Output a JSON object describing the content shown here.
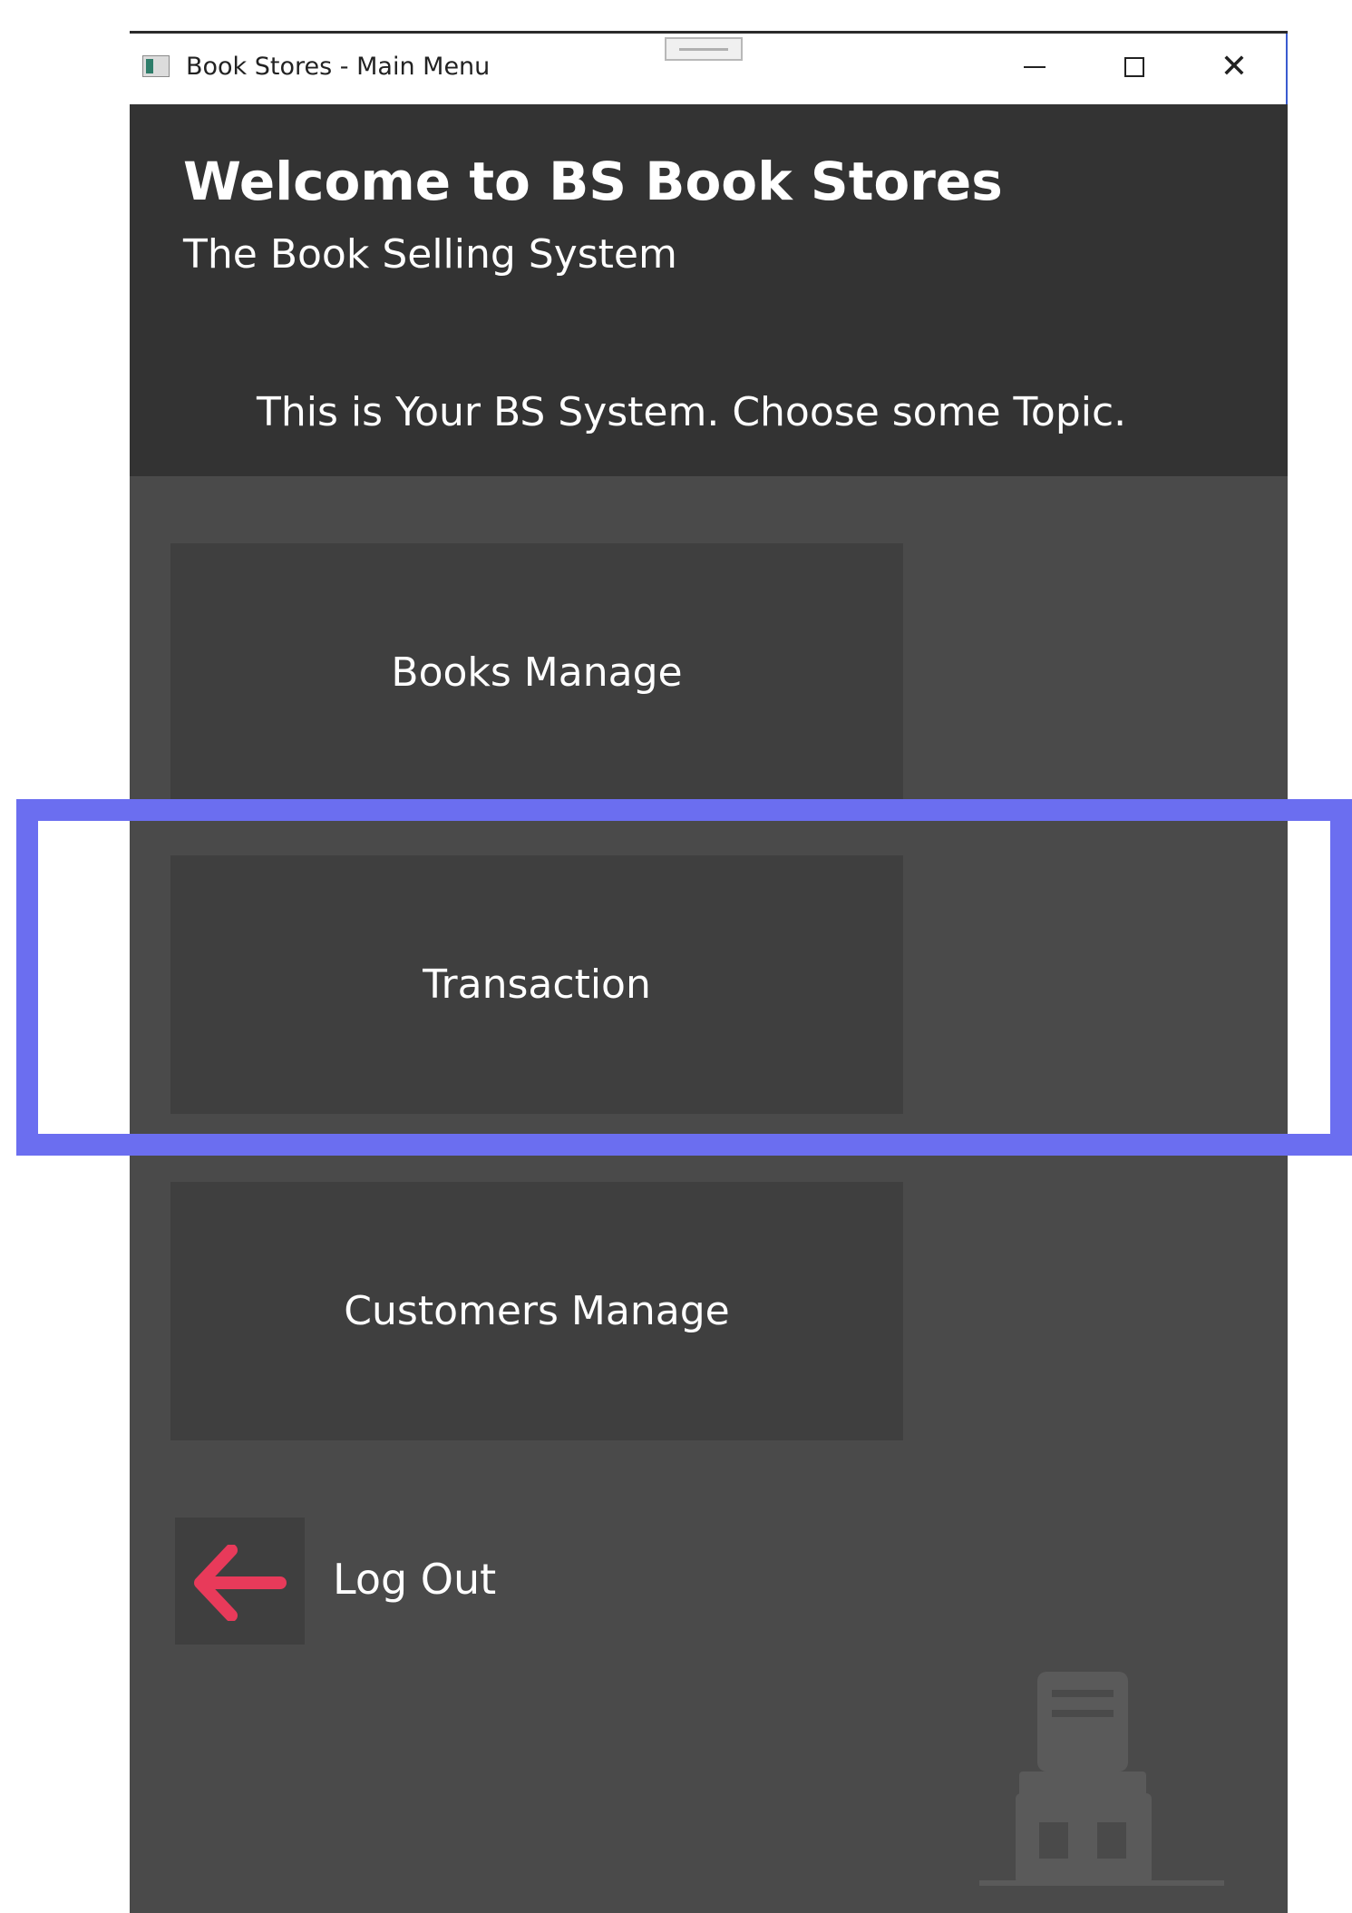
{
  "window": {
    "title": "Book Stores - Main Menu",
    "icon": "app-icon",
    "controls": [
      "minimize-icon",
      "maximize-icon",
      "close-icon"
    ],
    "close_glyph": "✕"
  },
  "header": {
    "welcome": "Welcome to BS Book Stores",
    "subtitle": "The Book Selling System",
    "prompt": "This is Your BS System. Choose some Topic."
  },
  "menu": {
    "books_label": "Books Manage",
    "transaction_label": "Transaction",
    "customers_label": "Customers Manage"
  },
  "logout": {
    "label": "Log Out",
    "icon": "arrow-left-icon",
    "icon_color": "#e83a5a"
  },
  "colors": {
    "header_bg": "#333333",
    "body_bg": "#4a4a4a",
    "button_bg": "#3f3f3f",
    "highlight": "#6b6ef0"
  }
}
